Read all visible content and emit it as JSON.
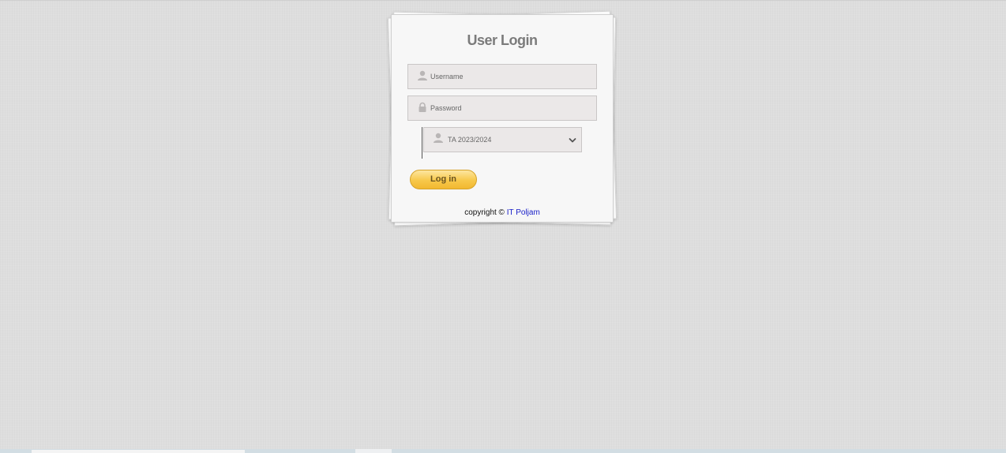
{
  "login": {
    "title": "User Login",
    "username_placeholder": "Username",
    "password_placeholder": "Password",
    "academic_year_selected": "TA 2023/2024",
    "login_button": "Log in"
  },
  "footer": {
    "copyright_prefix": "copyright ©",
    "company_link": "IT Poljam"
  },
  "icons": {
    "username": "user-icon",
    "password": "lock-icon",
    "year": "user-icon",
    "dropdown": "chevron-down-icon"
  },
  "colors": {
    "button_gradient_top": "#fde6a0",
    "button_gradient_bottom": "#f2b830",
    "link": "#1a20c8",
    "title": "#7b7b7b"
  }
}
